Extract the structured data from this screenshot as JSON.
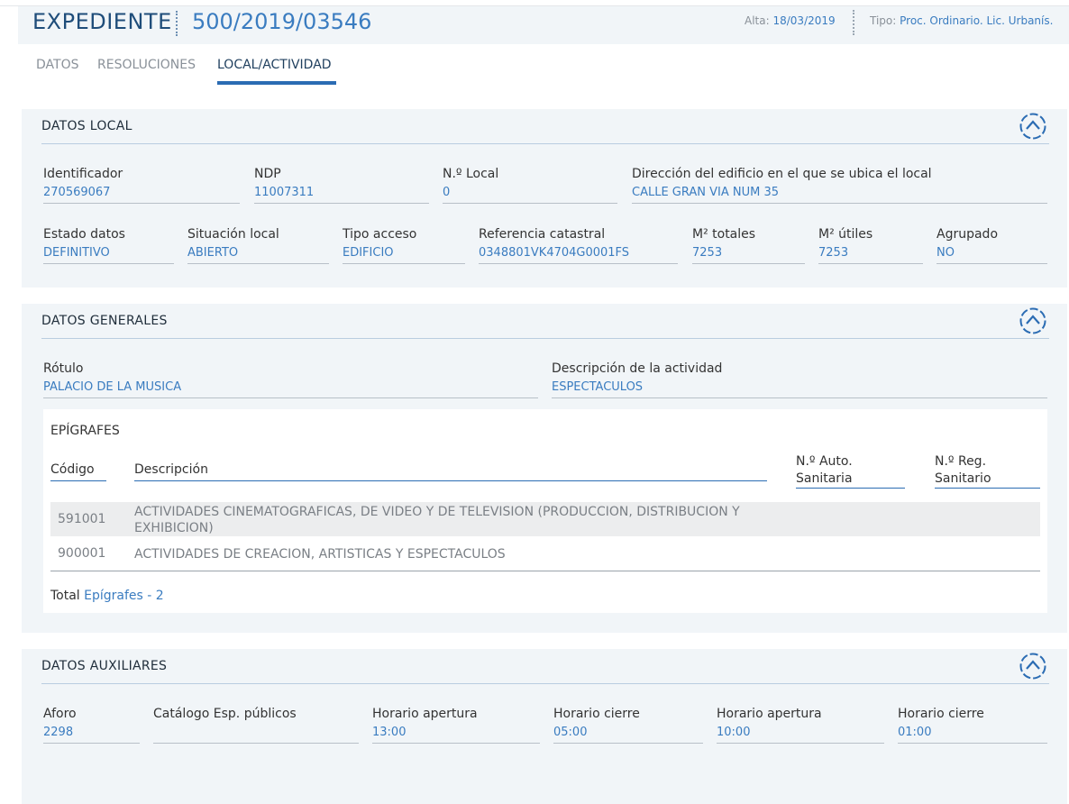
{
  "header": {
    "title": "EXPEDIENTE",
    "number": "500/2019/03546",
    "alta_label": "Alta:",
    "alta_value": "18/03/2019",
    "tipo_label": "Tipo:",
    "tipo_value": "Proc. Ordinario. Lic. Urbanís."
  },
  "tabs": [
    "DATOS",
    "RESOLUCIONES",
    "LOCAL/ACTIVIDAD"
  ],
  "active_tab": "LOCAL/ACTIVIDAD",
  "datos_local": {
    "title": "DATOS LOCAL",
    "fields": [
      {
        "label": "Identificador",
        "value": "270569067"
      },
      {
        "label": "NDP",
        "value": "11007311"
      },
      {
        "label": "N.º Local",
        "value": "0"
      },
      {
        "label": "Dirección del edificio en el que se ubica el local",
        "value": "CALLE GRAN VIA NUM 35"
      },
      {
        "label": "Estado datos",
        "value": "DEFINITIVO"
      },
      {
        "label": "Situación local",
        "value": "ABIERTO"
      },
      {
        "label": "Tipo acceso",
        "value": "EDIFICIO"
      },
      {
        "label": "Referencia catastral",
        "value": "0348801VK4704G0001FS"
      },
      {
        "label": "M² totales",
        "value": "7253"
      },
      {
        "label": "M² útiles",
        "value": "7253"
      },
      {
        "label": "Agrupado",
        "value": "NO"
      }
    ]
  },
  "datos_generales": {
    "title": "DATOS GENERALES",
    "fields": [
      {
        "label": "Rótulo",
        "value": "PALACIO DE LA MUSICA"
      },
      {
        "label": "Descripción de la actividad",
        "value": "ESPECTACULOS"
      }
    ],
    "epigrafes": {
      "title": "EPÍGRAFES",
      "columns": [
        "Código",
        "Descripción",
        "N.º Auto.\nSanitaria",
        "N.º Reg.\nSanitario"
      ],
      "rows": [
        {
          "code": "591001",
          "description": "ACTIVIDADES CINEMATOGRAFICAS, DE VIDEO Y DE TELEVISION (PRODUCCION, DISTRIBUCION Y EXHIBICION)"
        },
        {
          "code": "900001",
          "description": "ACTIVIDADES DE CREACION, ARTISTICAS Y ESPECTACULOS"
        }
      ],
      "total_label": "Total",
      "total_link": "Epígrafes - 2"
    }
  },
  "datos_auxiliares": {
    "title": "DATOS AUXILIARES",
    "fields": [
      {
        "label": "Aforo",
        "value": "2298"
      },
      {
        "label": "Catálogo Esp. públicos",
        "value": ""
      },
      {
        "label": "Horario apertura",
        "value": "13:00"
      },
      {
        "label": "Horario cierre",
        "value": "05:00"
      },
      {
        "label": "Horario apertura",
        "value": "10:00"
      },
      {
        "label": "Horario cierre",
        "value": "01:00"
      }
    ]
  },
  "icons": {
    "collapse": "chevron-up-circle-icon"
  },
  "colors": {
    "accent": "#3a7cc0",
    "title": "#1f4d7a",
    "panel_bg": "#f1f5f8",
    "tab_active": "#2b6cb3"
  }
}
